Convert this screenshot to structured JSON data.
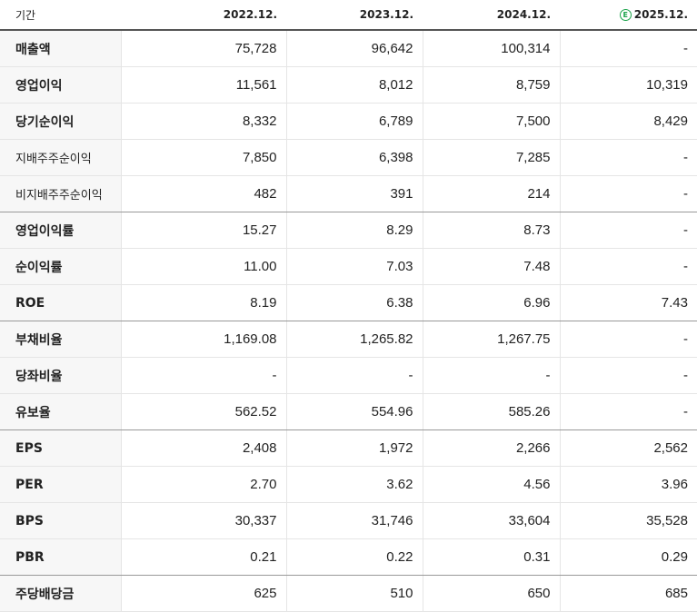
{
  "header": {
    "label": "기간",
    "periods": [
      "2022.12.",
      "2023.12.",
      "2024.12.",
      "2025.12."
    ],
    "estimate_marker": "E"
  },
  "rows": [
    {
      "label": "매출액",
      "values": [
        "75,728",
        "96,642",
        "100,314",
        "-"
      ]
    },
    {
      "label": "영업이익",
      "values": [
        "11,561",
        "8,012",
        "8,759",
        "10,319"
      ]
    },
    {
      "label": "당기순이익",
      "values": [
        "8,332",
        "6,789",
        "7,500",
        "8,429"
      ]
    },
    {
      "label": "지배주주순이익",
      "values": [
        "7,850",
        "6,398",
        "7,285",
        "-"
      ]
    },
    {
      "label": "비지배주주순이익",
      "values": [
        "482",
        "391",
        "214",
        "-"
      ]
    },
    {
      "label": "영업이익률",
      "values": [
        "15.27",
        "8.29",
        "8.73",
        "-"
      ]
    },
    {
      "label": "순이익률",
      "values": [
        "11.00",
        "7.03",
        "7.48",
        "-"
      ]
    },
    {
      "label": "ROE",
      "values": [
        "8.19",
        "6.38",
        "6.96",
        "7.43"
      ]
    },
    {
      "label": "부채비율",
      "values": [
        "1,169.08",
        "1,265.82",
        "1,267.75",
        "-"
      ]
    },
    {
      "label": "당좌비율",
      "values": [
        "-",
        "-",
        "-",
        "-"
      ]
    },
    {
      "label": "유보율",
      "values": [
        "562.52",
        "554.96",
        "585.26",
        "-"
      ]
    },
    {
      "label": "EPS",
      "values": [
        "2,408",
        "1,972",
        "2,266",
        "2,562"
      ]
    },
    {
      "label": "PER",
      "values": [
        "2.70",
        "3.62",
        "4.56",
        "3.96"
      ]
    },
    {
      "label": "BPS",
      "values": [
        "30,337",
        "31,746",
        "33,604",
        "35,528"
      ]
    },
    {
      "label": "PBR",
      "values": [
        "0.21",
        "0.22",
        "0.31",
        "0.29"
      ]
    },
    {
      "label": "주당배당금",
      "values": [
        "625",
        "510",
        "650",
        "685"
      ]
    }
  ],
  "colors": {
    "estimate_icon": "#1aa34a",
    "label_bg": "#f7f7f7"
  }
}
